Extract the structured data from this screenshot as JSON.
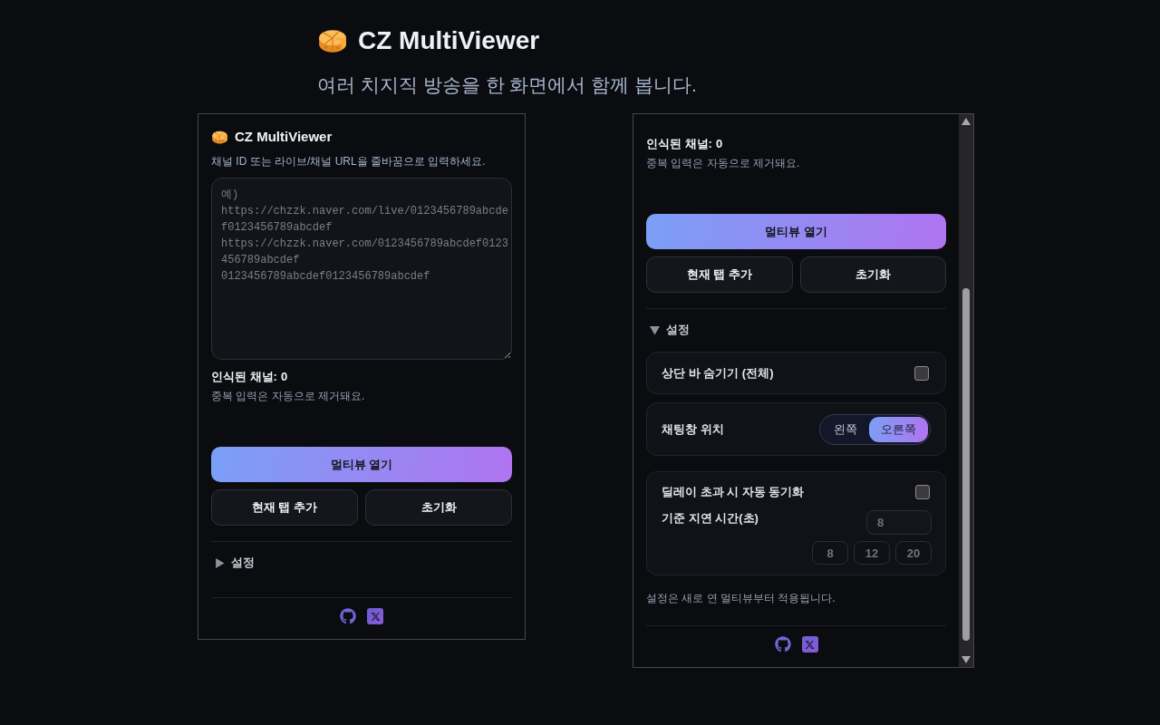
{
  "header": {
    "title": "CZ MultiViewer",
    "subtitle": "여러 치지직 방송을 한 화면에서 함께 봅니다."
  },
  "popups": [
    {
      "title": "CZ MultiViewer",
      "hint": "채널 ID 또는 라이브/채널 URL을 줄바꿈으로 입력하세요.",
      "channel_input": {
        "placeholder": "예)\nhttps://chzzk.naver.com/live/0123456789abcdef0123456789abcdef\nhttps://chzzk.naver.com/0123456789abcdef0123456789abcdef\n0123456789abcdef0123456789abcdef"
      },
      "recognized": {
        "label": "인식된 채널:",
        "count": "0"
      },
      "note": "중복 입력은 자동으로 제거돼요.",
      "primary_button": "멀티뷰 열기",
      "buttons": [
        "현재 탭 추가",
        "초기화"
      ],
      "settings": {
        "label": "설정",
        "expanded": false
      },
      "footer_links": [
        {
          "kind": "github"
        },
        {
          "kind": "x"
        }
      ]
    },
    {
      "recognized": {
        "label": "인식된 채널:",
        "count": "0"
      },
      "note": "중복 입력은 자동으로 제거돼요.",
      "primary_button": "멀티뷰 열기",
      "buttons": [
        "현재 탭 추가",
        "초기화"
      ],
      "settings": {
        "label": "설정",
        "expanded": true,
        "options": [
          {
            "kind": "checkbox",
            "label": "상단 바 숨기기 (전체)",
            "checked": false
          },
          {
            "kind": "segmented",
            "label": "채팅창 위치",
            "options": [
              {
                "label": "왼쪽",
                "selected": false
              },
              {
                "label": "오른쪽",
                "selected": true
              }
            ]
          },
          {
            "kind": "delay",
            "label": "딜레이 초과 시 자동 동기화",
            "checked": false,
            "sub_label": "기준 지연 시간(초)",
            "field": {
              "value": "8",
              "disabled": true
            },
            "presets": [
              {
                "label": "8",
                "disabled": true
              },
              {
                "label": "12",
                "disabled": true
              },
              {
                "label": "20",
                "disabled": true
              }
            ]
          }
        ],
        "footnote": "설정은 새로 연 멀티뷰부터 적용됩니다."
      },
      "footer_links": [
        {
          "kind": "github"
        },
        {
          "kind": "x"
        }
      ]
    }
  ]
}
